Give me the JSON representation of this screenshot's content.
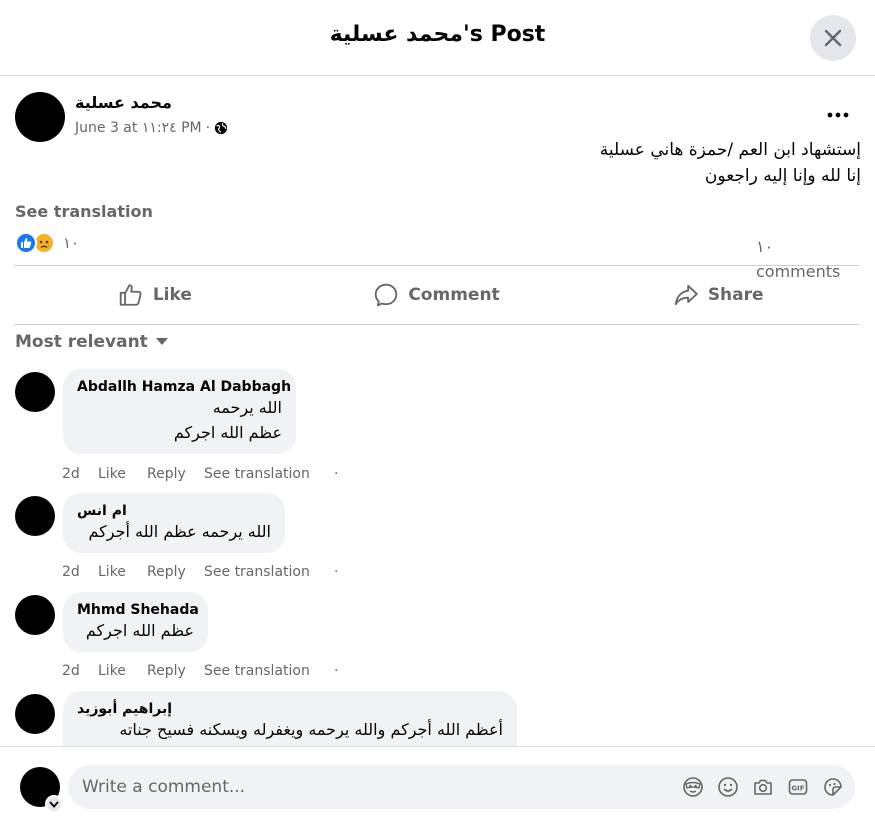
{
  "header": {
    "title": "محمد عسلية's Post"
  },
  "post": {
    "author": "محمد عسلية",
    "date": "June 3 at ١١:٢٤ PM",
    "meta_sep": "·",
    "body": [
      "إستشهاد ابن العم /حمزة هاني عسلية",
      "إنا لله وإنا إليه راجعون"
    ],
    "see_translation": "See translation",
    "reaction_count": "١٠",
    "comments_count": "١٠ comments",
    "audience_icon": "globe-icon"
  },
  "actions": {
    "like": "Like",
    "comment": "Comment",
    "share": "Share"
  },
  "sort": {
    "label": "Most relevant"
  },
  "comments": [
    {
      "name": "Abdallh Hamza Al Dabbagh",
      "lines": [
        "الله يرحمه",
        "عظم الله اجركم"
      ],
      "time": "2d",
      "like": "Like",
      "reply": "Reply",
      "translate": "See translation",
      "dot": "·"
    },
    {
      "name": "ام انس",
      "lines": [
        "الله يرحمه عظم الله أجركم"
      ],
      "time": "2d",
      "like": "Like",
      "reply": "Reply",
      "translate": "See translation",
      "dot": "·"
    },
    {
      "name": "Mhmd Shehada",
      "lines": [
        "عظم الله اجركم"
      ],
      "time": "2d",
      "like": "Like",
      "reply": "Reply",
      "translate": "See translation",
      "dot": "·"
    },
    {
      "name": "إبراهيم أبوزيد",
      "lines": [
        "أعظم الله أجركم والله يرحمه ويغفرله ويسكنه فسيح جناته"
      ]
    }
  ],
  "composer": {
    "placeholder": "Write a comment..."
  },
  "colors": {
    "accent": "#1877f2",
    "secondary_text": "#65676b",
    "bubble": "#f0f2f5"
  }
}
